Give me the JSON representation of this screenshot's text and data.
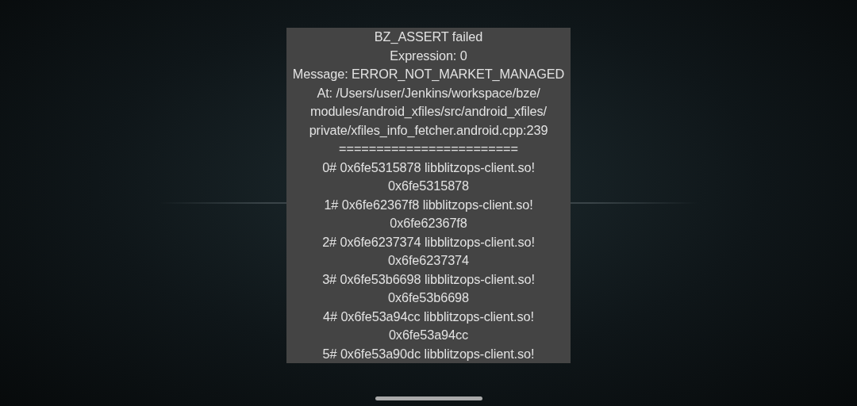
{
  "dialog": {
    "lines": [
      "BZ_ASSERT failed",
      "Expression: 0",
      "Message: ERROR_NOT_MARKET_MANAGED",
      "At: /Users/user/Jenkins/workspace/bze/",
      "modules/android_xfiles/src/android_xfiles/",
      "private/xfiles_info_fetcher.android.cpp:239",
      "========================",
      "0# 0x6fe5315878 libblitzops-client.so!",
      "0x6fe5315878",
      "1# 0x6fe62367f8 libblitzops-client.so!",
      "0x6fe62367f8",
      "2# 0x6fe6237374 libblitzops-client.so!",
      "0x6fe6237374",
      "3# 0x6fe53b6698 libblitzops-client.so!",
      "0x6fe53b6698",
      "4# 0x6fe53a94cc libblitzops-client.so!",
      "0x6fe53a94cc",
      "5# 0x6fe53a90dc libblitzops-client.so!"
    ]
  }
}
